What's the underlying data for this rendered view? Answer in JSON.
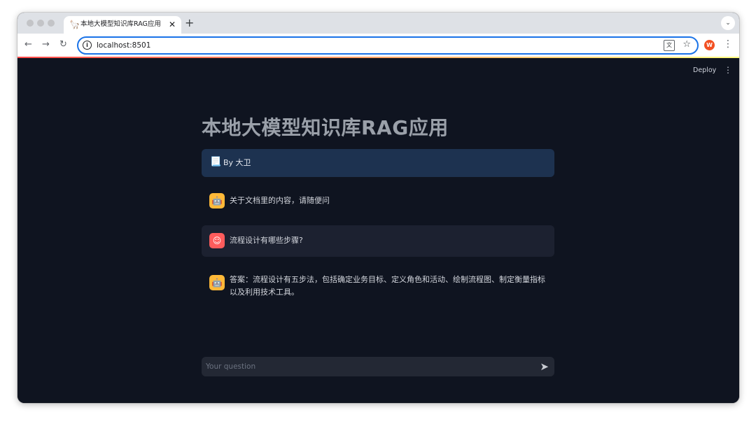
{
  "browser": {
    "tab": {
      "title": "本地大模型知识库RAG应用",
      "favicon": "llama-icon"
    },
    "new_tab": "+",
    "url": "localhost:8501",
    "extension_label": "W",
    "colors": {
      "omnibox_border": "#1a73e8",
      "extension": "#f25022"
    }
  },
  "app": {
    "deploy_label": "Deploy",
    "title": "本地大模型知识库RAG应用",
    "info": {
      "emoji": "📃",
      "text": "By 大卫"
    },
    "messages": [
      {
        "role": "assistant",
        "text": "关于文档里的内容，请随便问"
      },
      {
        "role": "user",
        "text": "流程设计有哪些步骤?"
      },
      {
        "role": "assistant",
        "text": "答案：流程设计有五步法，包括确定业务目标、定义角色和活动、绘制流程图、制定衡量指标以及利用技术工具。"
      }
    ],
    "input": {
      "placeholder": "Your question",
      "value": ""
    },
    "colors": {
      "background": "#0f1420",
      "info_box": "#1d3250",
      "bot_avatar": "#ffb938",
      "user_avatar": "#ff5c5c"
    }
  }
}
